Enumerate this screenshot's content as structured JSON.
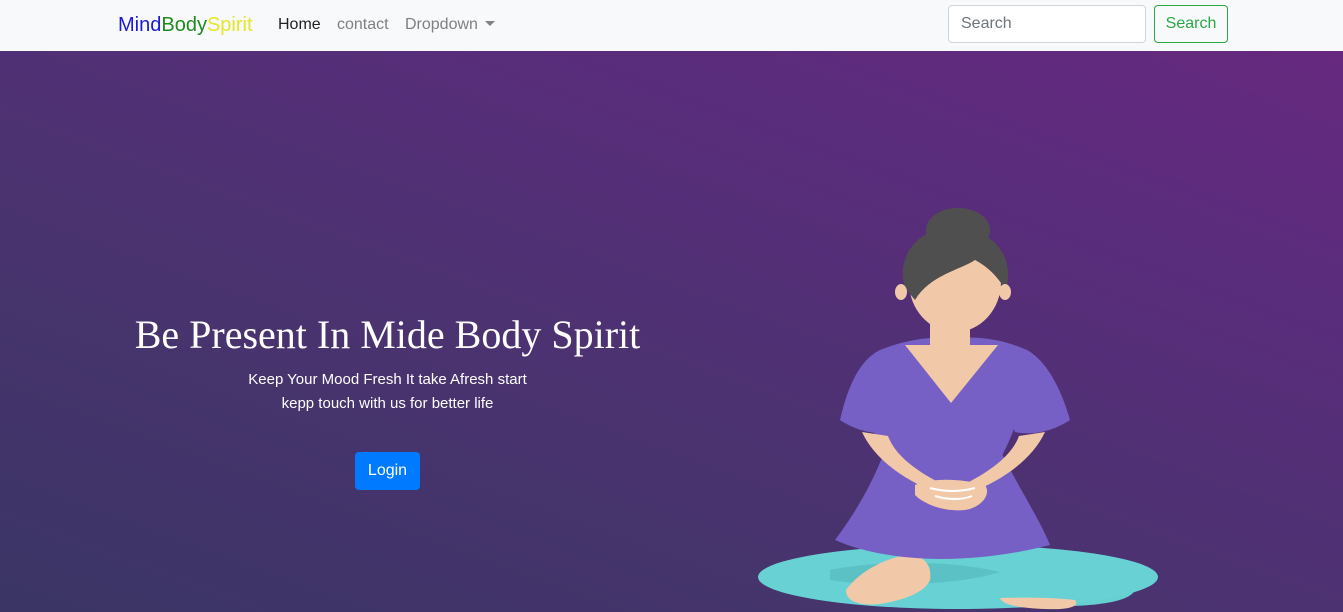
{
  "navbar": {
    "brand": {
      "part1": "Mind",
      "part2": "Body",
      "part3": "Spirit"
    },
    "brand_colors": {
      "part1": "#1a1ad6",
      "part2": "#1f8a1f",
      "part3": "#e6e62a"
    },
    "links": [
      {
        "label": "Home",
        "active": true
      },
      {
        "label": "contact",
        "active": false
      },
      {
        "label": "Dropdown",
        "active": false
      }
    ],
    "search": {
      "placeholder": "Search",
      "value": "",
      "button_label": "Search"
    }
  },
  "hero": {
    "title": "Be Present In Mide Body Spirit",
    "subtitle_line1": "Keep Your Mood Fresh It take Afresh start",
    "subtitle_line2": "kepp touch with us for better life",
    "login_label": "Login"
  },
  "icons": {
    "dropdown_caret": "caret-down-icon",
    "illustration": "meditating-woman-illustration"
  },
  "colors": {
    "accent_primary": "#007bff",
    "accent_success": "#28a745",
    "hero_gradient_start": "#3a3565",
    "hero_gradient_end": "#66297f",
    "navbar_bg": "#f8f9fa"
  }
}
